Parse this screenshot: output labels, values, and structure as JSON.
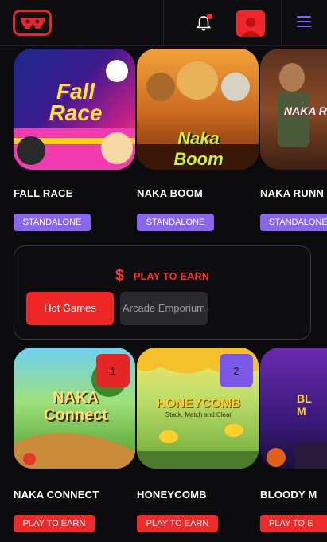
{
  "header": {
    "logo": "naka-logo",
    "notification_icon": "bell-icon",
    "avatar_icon": "user-icon",
    "menu_icon": "hamburger-icon"
  },
  "featured": [
    {
      "title": "FALL RACE",
      "badge": "STANDALONE",
      "art_text": "Fall Race"
    },
    {
      "title": "NAKA BOOM",
      "badge": "STANDALONE",
      "art_text": "Naka Boom"
    },
    {
      "title": "NAKA RUNN",
      "badge": "STANDALONE",
      "art_text": "NAKA RUNN"
    }
  ],
  "play_to_earn": {
    "icon": "dollar-icon",
    "heading": "PLAY TO EARN",
    "tabs": [
      {
        "label": "Hot Games",
        "active": true
      },
      {
        "label": "Arcade Emporium",
        "active": false
      }
    ]
  },
  "hot_games": [
    {
      "rank": "1",
      "title": "NAKA CONNECT",
      "badge": "PLAY TO EARN",
      "art_text": "NAKA Connect",
      "rank_color": "#e62626"
    },
    {
      "rank": "2",
      "title": "HONEYCOMB",
      "badge": "PLAY TO EARN",
      "art_text": "HONEYCOMB",
      "art_sub": "Stack, Match and Clear",
      "rank_color": "#7c56e6"
    },
    {
      "rank": "",
      "title": "BLOODY M",
      "badge": "PLAY TO E",
      "art_text": "BL M"
    }
  ],
  "colors": {
    "accent_red": "#ef2a2a",
    "accent_purple": "#8a67ea",
    "background": "#0b0b0d"
  }
}
